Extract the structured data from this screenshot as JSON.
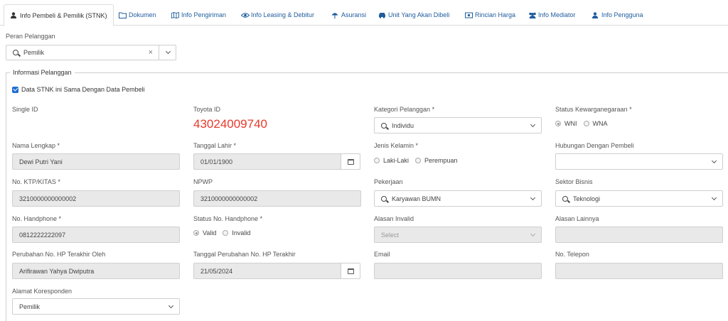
{
  "tabs": [
    {
      "label": "Info Pembeli & Pemilik (STNK)",
      "icon": "user-icon",
      "active": true
    },
    {
      "label": "Dokumen",
      "icon": "folder-icon"
    },
    {
      "label": "Info Pengiriman",
      "icon": "map-icon"
    },
    {
      "label": "Info Leasing & Debitur",
      "icon": "eye-icon"
    },
    {
      "label": "Asuransi",
      "icon": "umbrella-icon"
    },
    {
      "label": "Unit Yang Akan Dibeli",
      "icon": "car-icon"
    },
    {
      "label": "Rincian Harga",
      "icon": "money-icon"
    },
    {
      "label": "Info Mediator",
      "icon": "users-icon"
    },
    {
      "label": "Info Pengguna",
      "icon": "user-icon"
    }
  ],
  "peran": {
    "label": "Peran Pelanggan",
    "value": "Pemilik",
    "clear": "×"
  },
  "section": {
    "legend": "Informasi Pelanggan",
    "checkbox_label": "Data STNK ini Sama Dengan Data Pembeli"
  },
  "form": {
    "single_id": {
      "label": "Single ID"
    },
    "toyota_id": {
      "label": "Toyota ID",
      "value": "43024009740"
    },
    "kategori": {
      "label": "Kategori Pelanggan *",
      "value": "Individu"
    },
    "kewarganegaraan": {
      "label": "Status Kewarganegaraan *",
      "opt1": "WNI",
      "opt2": "WNA"
    },
    "nama": {
      "label": "Nama Lengkap *",
      "value": "Dewi Putri Yani"
    },
    "tgl_lahir": {
      "label": "Tanggal Lahir *",
      "value": "01/01/1900"
    },
    "jenis_kelamin": {
      "label": "Jenis Kelamin *",
      "opt1": "Laki-Laki",
      "opt2": "Perempuan"
    },
    "hubungan": {
      "label": "Hubungan Dengan Pembeli"
    },
    "ktp": {
      "label": "No. KTP/KITAS *",
      "value": "3210000000000002"
    },
    "npwp": {
      "label": "NPWP",
      "value": "3210000000000002"
    },
    "pekerjaan": {
      "label": "Pekerjaan",
      "value": "Karyawan BUMN"
    },
    "sektor": {
      "label": "Sektor Bisnis",
      "value": "Teknologi"
    },
    "handphone": {
      "label": "No. Handphone *",
      "value": "0812222222097"
    },
    "status_hp": {
      "label": "Status No. Handphone *",
      "opt1": "Valid",
      "opt2": "Invalid"
    },
    "alasan_invalid": {
      "label": "Alasan Invalid",
      "placeholder": "Select"
    },
    "alasan_lainnya": {
      "label": "Alasan Lainnya"
    },
    "perubahan_oleh": {
      "label": "Perubahan No. HP Terakhir Oleh",
      "value": "Arifirawan Yahya Dwiputra"
    },
    "tgl_perubahan": {
      "label": "Tanggal Perubahan No. HP Terakhir",
      "value": "21/05/2024"
    },
    "email": {
      "label": "Email"
    },
    "telepon": {
      "label": "No. Telepon"
    },
    "alamat": {
      "label": "Alamat Koresponden",
      "value": "Pemilik"
    }
  },
  "colors": {
    "toyota_id": "#e8392b",
    "link": "#1f5c9e",
    "accent": "#1f6fd1"
  }
}
